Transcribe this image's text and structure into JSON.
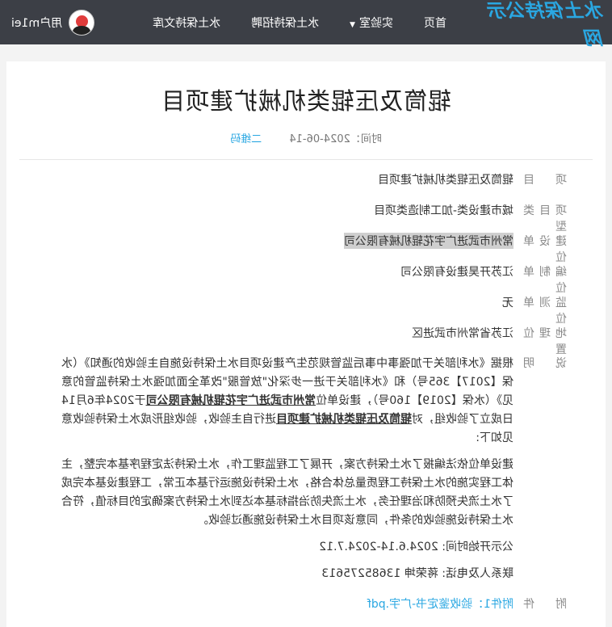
{
  "header": {
    "logo": "水土保持公示网",
    "nav": {
      "home": "首页",
      "lab": "实验室",
      "recruit": "水土保持招聘",
      "library": "水土保持文库"
    },
    "user": "用户m1ei"
  },
  "article": {
    "title": "辊筒及压辊类机械扩建项目",
    "time_label": "时间：2024-06-14",
    "qr_label": "二维码"
  },
  "fields": {
    "project_label": "项目",
    "project_value": "辊筒及压辊类机械扩建项目",
    "type_label": "项目类型",
    "type_value": "城市建设类-加工制造类项目",
    "builder_label": "建设单位",
    "builder_value": "常州市武进广宇花辊机械有限公司",
    "compiler_label": "编制单位",
    "compiler_value": "江苏开昊建设有限公司",
    "monitor_label": "监测单位",
    "monitor_value": "无",
    "location_label": "地理位置",
    "location_value": "江苏省常州市武进区",
    "desc_label": "说明",
    "attach_label": "附件",
    "attach_value": "附件1：验收鉴定书-广宇.pdf"
  },
  "description": {
    "p1_a": "根据《水利部关于加强事中事后监管规范生产建设项目水土保持设施自主验收的通知》（水保【2017】365号）和《水利部关于进一步深化\"放管服\"改革全面加强水土保持监管的意见》（水保【2019】160号），建设单位",
    "p1_b": "常州市武进广宇花辊机械有限公司",
    "p1_c": "于2024年6月14日成立了验收组，对",
    "p1_d": "辊筒及压辊类机械扩建项目",
    "p1_e": "进行自主验收，验收组形成水土保持验收意见如下:",
    "p2": "建设单位依法编报了水土保持方案，开展了工程监理工作，水土保持法定程序基本完整，主体工程实施的水土保持工程质量总体合格，水土保持设施运行基本正常，工程建设基本完成了水土流失预防和治理任务，水土流失防治指标基本达到水土保持方案确定的目标值，符合水土保持设施验收的条件，同意该项目水土保持设施通过验收。",
    "p3": "公示开始时间: 2024.6.14-2024.7.12",
    "p4": "联系人及电话: 蒋荣坤 13685275613"
  }
}
